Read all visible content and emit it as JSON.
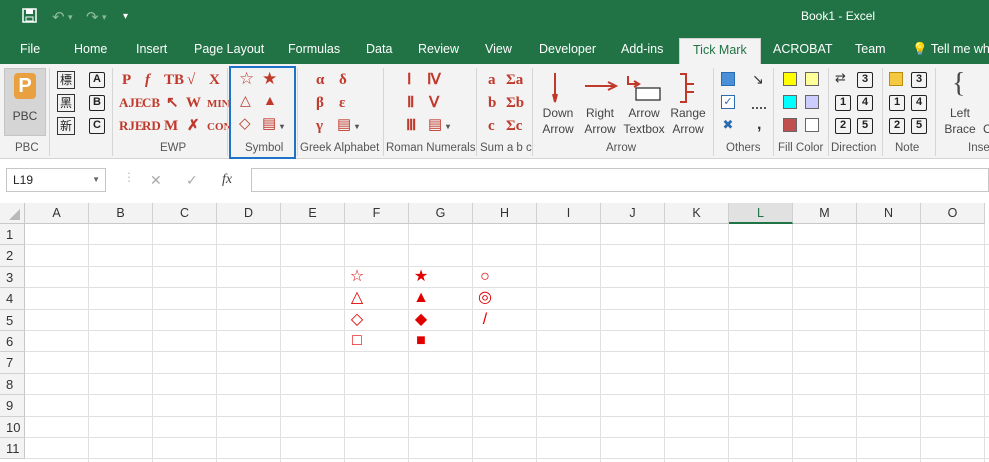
{
  "app": {
    "title": "Book1  -  Excel"
  },
  "quick_access": {
    "save_icon": "save-icon",
    "undo_icon": "undo-icon",
    "redo_icon": "redo-icon",
    "customize_icon": "customize-icon"
  },
  "tabs": [
    "File",
    "Home",
    "Insert",
    "Page Layout",
    "Formulas",
    "Data",
    "Review",
    "View",
    "Developer",
    "Add-ins",
    "Tick Mark",
    "ACROBAT",
    "Team",
    "Tell me wha"
  ],
  "active_tab": "Tick Mark",
  "ribbon": {
    "pbc": {
      "button_label": "PBC",
      "group_label": "PBC"
    },
    "kanji_btns": [
      "標",
      "黑",
      "新"
    ],
    "boxed_letters": [
      "A",
      "B",
      "C"
    ],
    "ewp": {
      "group_label": "EWP",
      "icons": [
        "P",
        "f",
        "TB",
        "√",
        "X",
        "AJE",
        "CB",
        "↖",
        "W",
        "MIN",
        "RJE",
        "RD",
        "M",
        "✗",
        "CON"
      ]
    },
    "symbol": {
      "group_label": "Symbol",
      "icons": [
        "☆",
        "★",
        "△",
        "▲",
        "◇",
        "▤"
      ]
    },
    "greek": {
      "group_label": "Greek Alphabet",
      "icons": [
        "α",
        "δ",
        "β",
        "ε",
        "γ",
        "▤"
      ]
    },
    "roman": {
      "group_label": "Roman Numerals",
      "icons": [
        "Ⅰ",
        "Ⅳ",
        "Ⅱ",
        "Ⅴ",
        "Ⅲ",
        "▤"
      ]
    },
    "sum": {
      "group_label": "Sum a b c",
      "icons": [
        "a",
        "Σa",
        "b",
        "Σb",
        "c",
        "Σc"
      ]
    },
    "arrow": {
      "group_label": "Arrow",
      "buttons": [
        {
          "line1": "Down",
          "line2": "Arrow"
        },
        {
          "line1": "Right",
          "line2": "Arrow"
        },
        {
          "line1": "Arrow",
          "line2": "Textbox"
        },
        {
          "line1": "Range",
          "line2": "Arrow"
        }
      ]
    },
    "others": {
      "group_label": "Others"
    },
    "fill_color": {
      "group_label": "Fill Color",
      "colors": [
        "#ffff00",
        "#ffff99",
        "#00ffff",
        "#ccccff",
        "#c0504d",
        "#ffffff"
      ]
    },
    "direction": {
      "group_label": "Direction",
      "numbers": [
        "3",
        "1",
        "4",
        "2",
        "5"
      ]
    },
    "note": {
      "group_label": "Note",
      "numbers": [
        "3",
        "1",
        "4",
        "2",
        "5"
      ]
    },
    "insert": {
      "group_label": "Inse",
      "line1": "Left",
      "line2": "Brace",
      "extra": "C"
    }
  },
  "formula_bar": {
    "name_box": "L19",
    "cancel": "✕",
    "enter": "✓",
    "fx": "fx",
    "value": ""
  },
  "columns": [
    "A",
    "B",
    "C",
    "D",
    "E",
    "F",
    "G",
    "H",
    "I",
    "J",
    "K",
    "L",
    "M",
    "N",
    "O"
  ],
  "selected_column": "L",
  "rows": [
    "1",
    "2",
    "3",
    "4",
    "5",
    "6",
    "7",
    "8",
    "9",
    "10",
    "11"
  ],
  "cells": {
    "F3": "☆",
    "G3": "★",
    "H3": "○",
    "F4": "△",
    "G4": "▲",
    "H4": "◎",
    "F5": "◇",
    "G5": "◆",
    "H5": "/",
    "F6": "□",
    "G6": "■"
  }
}
